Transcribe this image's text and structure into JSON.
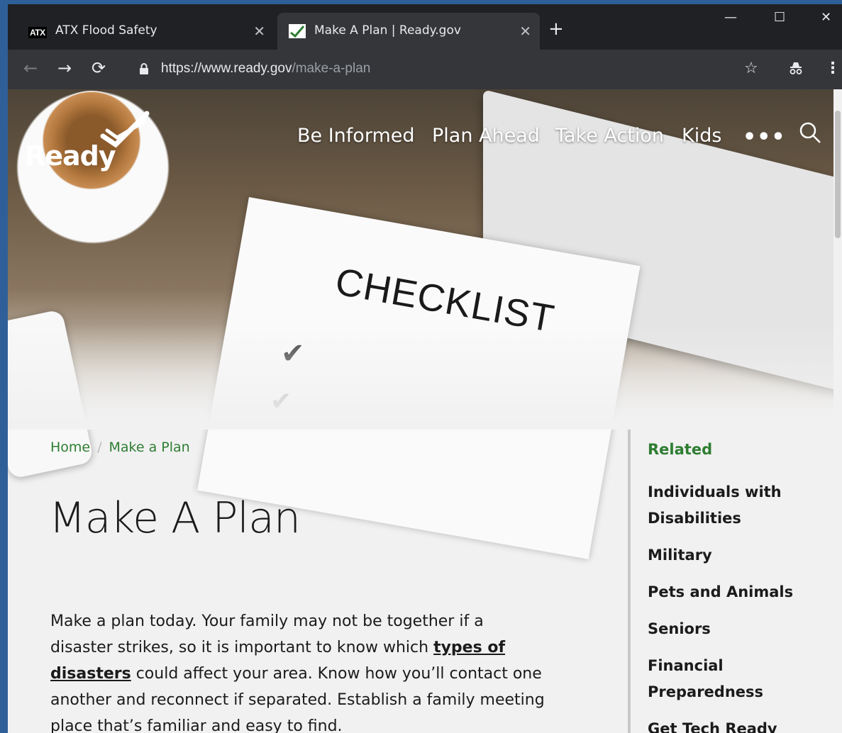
{
  "browser": {
    "tabs": [
      {
        "title": "ATX Flood Safety",
        "favicon": "ATX",
        "active": false
      },
      {
        "title": "Make A Plan | Ready.gov",
        "favicon": "ready-check-icon",
        "active": true
      }
    ],
    "url_host": "https://www.ready.gov",
    "url_path": "/make-a-plan"
  },
  "site": {
    "logo_text": "Ready",
    "nav": [
      "Be Informed",
      "Plan Ahead",
      "Take Action",
      "Kids"
    ],
    "more_label": "•••"
  },
  "hero": {
    "notebook_text": "CHECKLIST"
  },
  "breadcrumb": {
    "home": "Home",
    "sep": "/",
    "current": "Make a Plan"
  },
  "main": {
    "title": "Make A Plan",
    "intro_part1": "Make a plan today. Your family may not be together if a disaster strikes, so it is important to know which ",
    "intro_link": "types of disasters",
    "intro_part2": " could affect your area.  Know how you’ll contact one another and reconnect if separated. Establish a family meeting place that’s familiar and easy to find."
  },
  "sidebar": {
    "heading": "Related",
    "items": [
      "Individuals with Disabilities",
      "Military",
      "Pets and Animals",
      "Seniors",
      "Financial Preparedness",
      "Get Tech Ready"
    ]
  },
  "colors": {
    "accent_green": "#2e7d32",
    "chrome_dark": "#202124",
    "chrome_toolbar": "#35363a"
  }
}
